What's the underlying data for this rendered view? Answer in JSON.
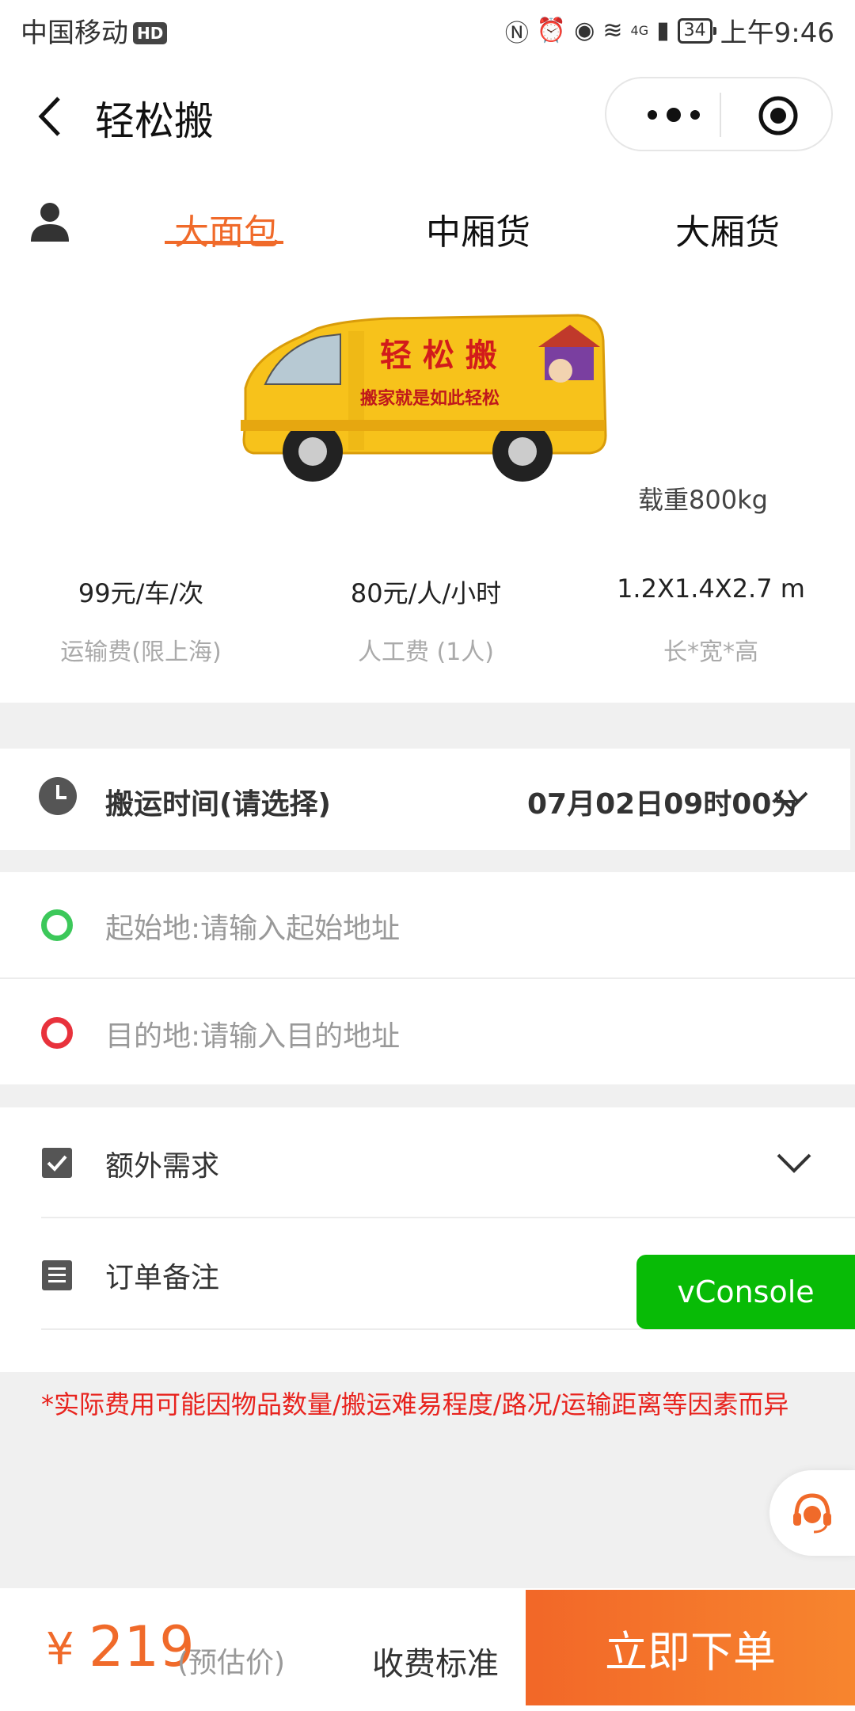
{
  "status_bar": {
    "carrier": "中国移动",
    "hd": "HD",
    "network": "4G",
    "battery": "34",
    "time": "上午9:46"
  },
  "nav": {
    "title": "轻松搬",
    "back_icon": "chevron-left-icon",
    "more_icon": "more-dots-icon",
    "close_icon": "target-icon"
  },
  "tabs": {
    "items": [
      "大面包",
      "中厢货",
      "大厢货"
    ],
    "active_index": 0,
    "active_color": "#f06a2a"
  },
  "vehicle": {
    "van_text_main": "轻 松 搬",
    "van_text_sub": "搬家就是如此轻松",
    "capacity": "载重800kg",
    "specs": [
      {
        "value": "99元/车/次",
        "label": "运输费(限上海)"
      },
      {
        "value": "80元/人/小时",
        "label": "人工费 (1人)"
      },
      {
        "value": "1.2X1.4X2.7 m",
        "label": "长*宽*高"
      }
    ]
  },
  "time": {
    "label": "搬运时间(请选择)",
    "value": "07月02日09时00分"
  },
  "address": {
    "origin_label": "起始地:",
    "origin_placeholder": "请输入起始地址",
    "dest_label": "目的地:",
    "dest_placeholder": "请输入目的地址"
  },
  "extras": {
    "requirements_label": "额外需求",
    "note_label": "订单备注"
  },
  "vconsole": "vConsole",
  "disclaimer": "*实际费用可能因物品数量/搬运难易程度/路况/运输距离等因素而异",
  "bottom": {
    "currency": "¥",
    "price": "219",
    "price_note": "(预估价)",
    "fee_standard": "收费标准",
    "order_button": "立即下单"
  },
  "colors": {
    "accent": "#f06a2a",
    "green": "#3cc85a",
    "red": "#e8323c",
    "vconsole": "#08bb06"
  }
}
